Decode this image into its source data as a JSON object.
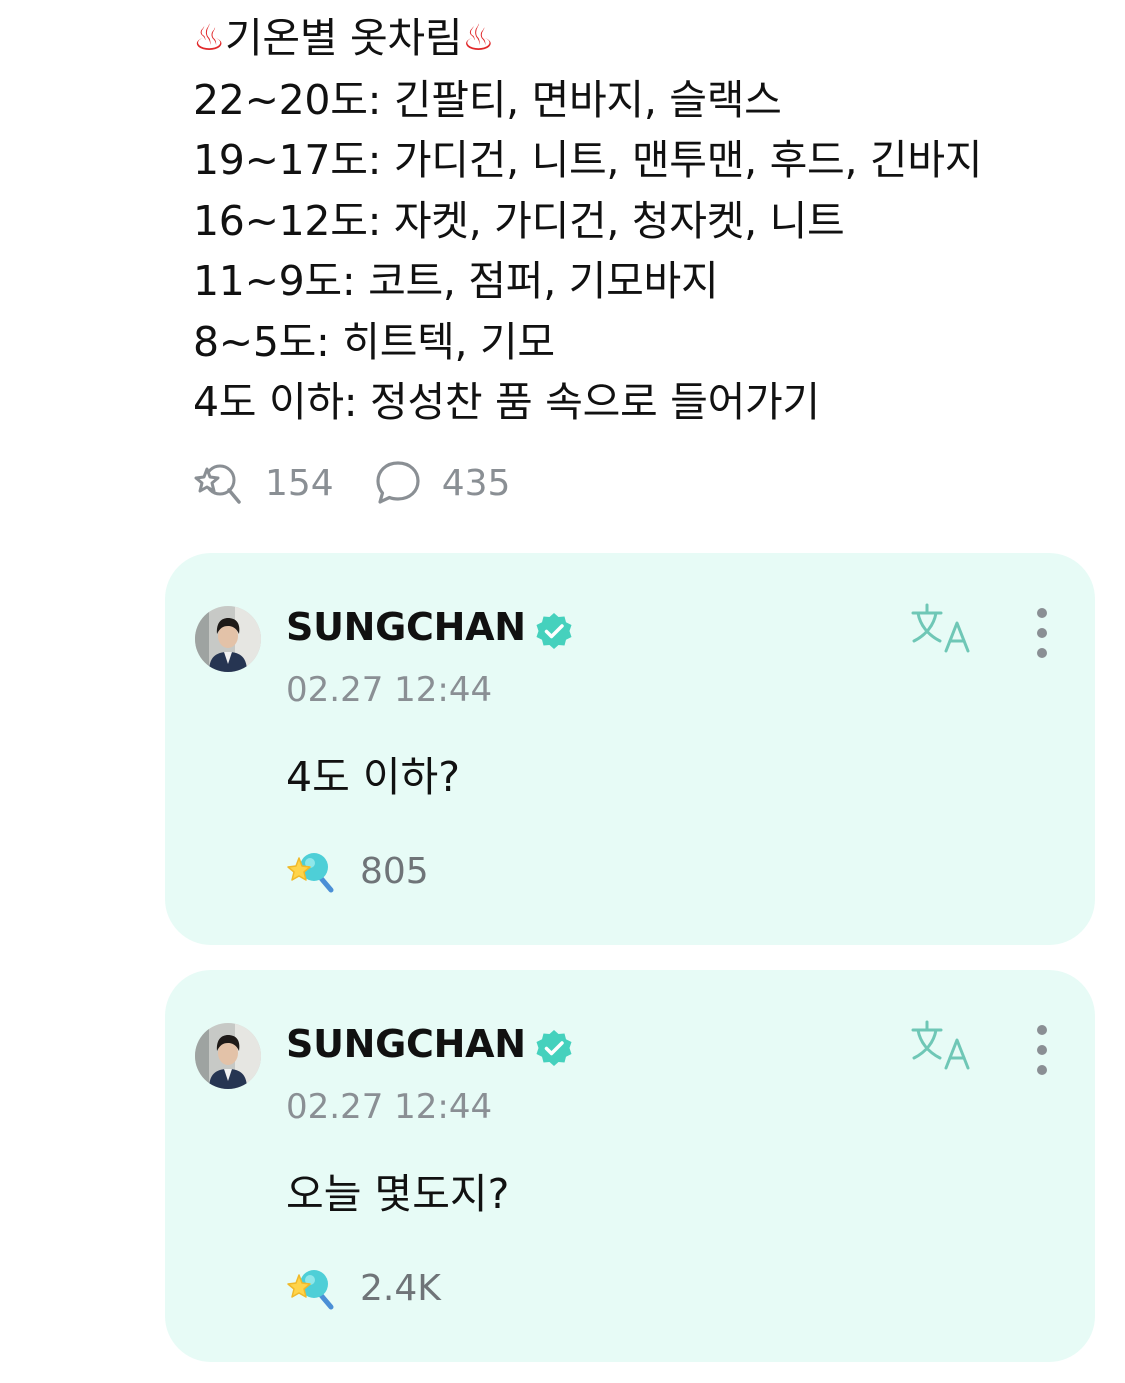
{
  "post": {
    "title_emoji": "♨",
    "title": "기온별 옷차림",
    "lines": [
      "22~20도: 긴팔티, 면바지, 슬랙스",
      "19~17도: 가디건, 니트, 맨투맨, 후드, 긴바지",
      "16~12도: 자켓, 가디건, 청자켓, 니트",
      "11~9도: 코트, 점퍼, 기모바지",
      "8~5도: 히트텍, 기모",
      "4도 이하: 정성찬 품 속으로 들어가기"
    ],
    "reaction_count": "154",
    "comment_count": "435"
  },
  "comments": [
    {
      "author": "SUNGCHAN",
      "timestamp": "02.27 12:44",
      "text": "4도 이하?",
      "reaction_count": "805"
    },
    {
      "author": "SUNGCHAN",
      "timestamp": "02.27 12:44",
      "text": "오늘 몇도지?",
      "reaction_count": "2.4K"
    }
  ],
  "icons": {
    "reaction": "star-pompom-icon",
    "comment": "speech-bubble-icon",
    "verified": "verified-badge-icon",
    "translate": "translate-icon",
    "more": "more-vertical-icon"
  },
  "colors": {
    "comment_background": "#e7fbf6",
    "verified": "#45d1bd",
    "muted_text": "#8a8f94",
    "hot_springs": "#e0282a"
  }
}
